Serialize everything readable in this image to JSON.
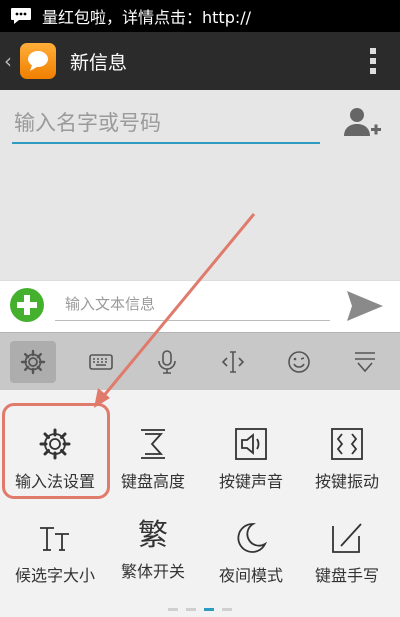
{
  "status_bar": {
    "notification_icon": "chat-bubble-icon",
    "text": "量红包啦，详情点击：http://"
  },
  "action_bar": {
    "back_icon": "chevron-left-icon",
    "app_icon": "message-app-icon",
    "title": "新信息",
    "overflow_icon": "overflow-menu-icon"
  },
  "recipient": {
    "placeholder": "输入名字或号码",
    "add_contact_icon": "add-contact-icon"
  },
  "compose": {
    "attach_icon": "plus-circle-icon",
    "placeholder": "输入文本信息",
    "send_icon": "send-icon"
  },
  "keyboard_toolbar": {
    "tools": [
      "gear-icon",
      "keyboard-icon",
      "microphone-icon",
      "cursor-icon",
      "emoji-icon",
      "collapse-icon"
    ],
    "active_tool": "gear-icon"
  },
  "keyboard_panel": {
    "items": [
      {
        "label": "输入法设置",
        "icon": "gear-icon"
      },
      {
        "label": "键盘高度",
        "icon": "keyboard-height-icon"
      },
      {
        "label": "按键声音",
        "icon": "speaker-icon"
      },
      {
        "label": "按键振动",
        "icon": "vibrate-icon"
      },
      {
        "label": "候选字大小",
        "icon": "text-size-icon"
      },
      {
        "label": "繁体开关",
        "icon": "traditional-chinese-icon",
        "glyph": "繁"
      },
      {
        "label": "夜间模式",
        "icon": "moon-icon"
      },
      {
        "label": "键盘手写",
        "icon": "handwriting-icon"
      }
    ],
    "highlighted_item": "输入法设置",
    "current_page": 3,
    "page_count": 4
  },
  "colors": {
    "status_bar_bg": "#000000",
    "action_bar_bg": "#2b2b2b",
    "app_icon_orange": "#f59a1d",
    "input_underline": "#2e9bc0",
    "attach_green": "#45b02d",
    "annotation_red": "#e07a6b"
  }
}
